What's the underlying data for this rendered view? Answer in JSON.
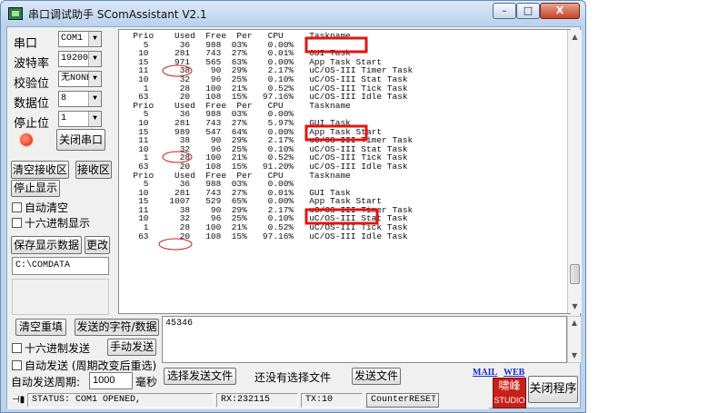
{
  "window": {
    "title": "串口调试助手 SComAssistant V2.1",
    "controls": {
      "minimize": "–",
      "maximize": "□",
      "close": "X"
    }
  },
  "settings": {
    "port_label": "串口",
    "port_value": "COM1",
    "baud_label": "波特率",
    "baud_value": "19200",
    "parity_label": "校验位",
    "parity_value": "无NONE",
    "databits_label": "数据位",
    "databits_value": "8",
    "stopbits_label": "停止位",
    "stopbits_value": "1",
    "close_port_button": "关闭串口"
  },
  "receive_controls": {
    "clear_button": "清空接收区",
    "receive_area_button": "接收区",
    "stop_display_button": "停止显示",
    "auto_clear_label": "自动清空",
    "hex_display_label": "十六进制显示",
    "save_button": "保存显示数据",
    "change_button": "更改",
    "save_path": "C:\\COMDATA"
  },
  "receive_text": "  Prio    Used  Free  Per   CPU     Taskname\n    5      36   988  03%    0.00%\n   10     281   743  27%    0.01%   GUI Task\n   15     971   565  63%    0.00%   App Task Start\n   11      38    90  29%    2.17%   uC/OS-III Timer Task\n   10      32    96  25%    0.10%   uC/OS-III Stat Task\n    1      28   100  21%    0.52%   uC/OS-III Tick Task\n   63      20   108  15%   97.16%   uC/OS-III Idle Task\n  Prio    Used  Free  Per   CPU     Taskname\n    5      36   988  03%    0.00%\n   10     281   743  27%    5.97%   GUI Task\n   15     989   547  64%    0.00%   App Task Start\n   11      38    90  29%    2.17%   uC/OS-III Timer Task\n   10      32    96  25%    0.10%   uC/OS-III Stat Task\n    1      28   100  21%    0.52%   uC/OS-III Tick Task\n   63      20   108  15%   91.20%   uC/OS-III Idle Task\n  Prio    Used  Free  Per   CPU     Taskname\n    5      36   988  03%    0.00%\n   10     281   743  27%    0.01%   GUI Task\n   15    1007   529  65%    0.00%   App Task Start\n   11      38    90  29%    2.17%   uC/OS-III Timer Task\n   10      32    96  25%    0.10%   uC/OS-III Stat Task\n    1      28   100  21%    0.52%   uC/OS-III Tick Task\n   63      20   108  15%   97.16%   uC/OS-III Idle Task",
  "annotations": {
    "circle_color": "#c8201a",
    "redact_color": "#e01515"
  },
  "send_controls": {
    "clear_resend_button": "清空重填",
    "send_chars_button": "发送的字符/数据",
    "send_text": "45346",
    "hex_send_label": "十六进制发送",
    "manual_send_button": "手动发送",
    "auto_send_label": "自动发送 (周期改变后重选)",
    "period_label": "自动发送周期:",
    "period_value": "1000",
    "period_unit": "毫秒",
    "select_file_button": "选择发送文件",
    "no_file_text": "还没有选择文件",
    "send_file_button": "发送文件",
    "mail_link": "MAIL",
    "web_link": "WEB",
    "close_program_button": "关闭程序"
  },
  "logo": {
    "line1": "啸峰",
    "line2": "STUDIO"
  },
  "status": {
    "status_text": "STATUS: COM1 OPENED,",
    "rx_text": "RX:232115",
    "tx_text": "TX:10",
    "counter_reset": "CounterRESET"
  }
}
